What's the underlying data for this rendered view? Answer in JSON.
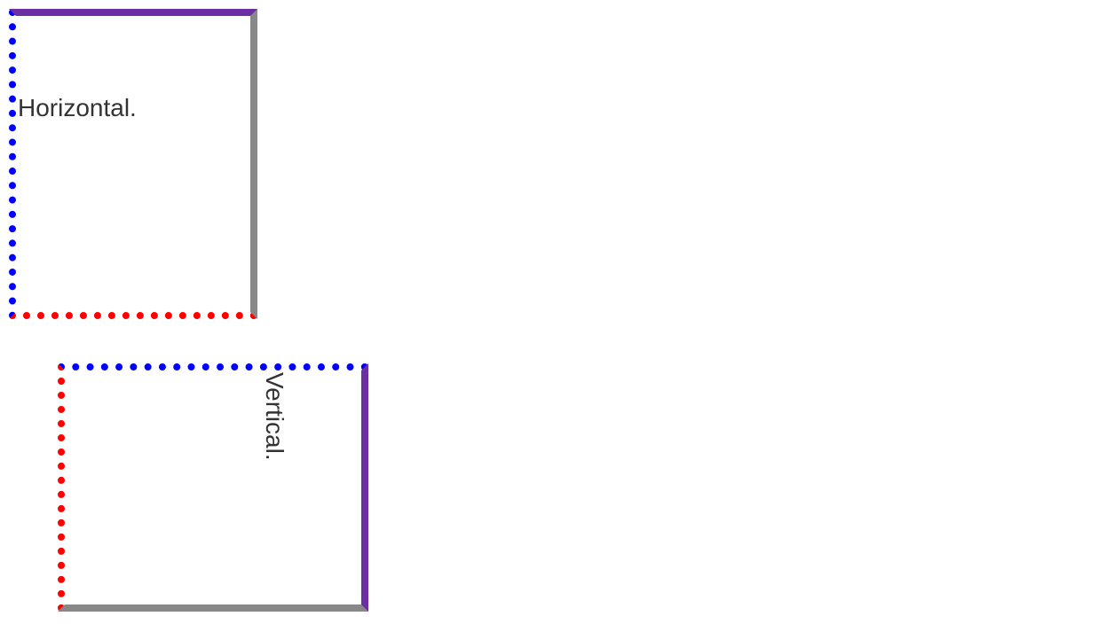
{
  "box1": {
    "label": "Horizontal."
  },
  "box2": {
    "label": "Vertical."
  }
}
